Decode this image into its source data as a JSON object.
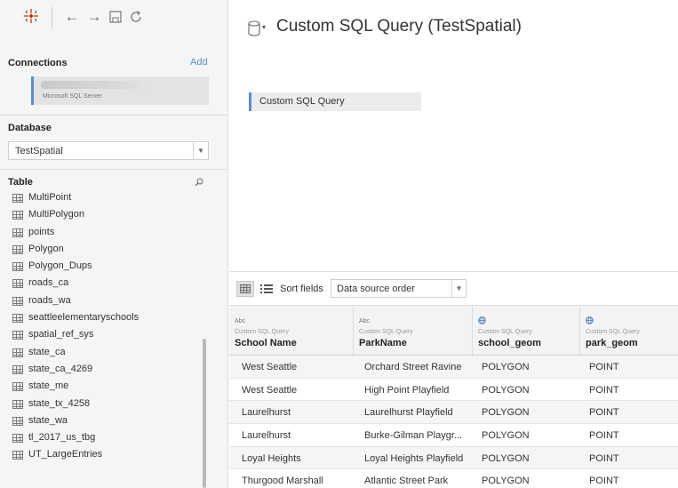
{
  "toolbar": {
    "icons": [
      "tableau-logo-icon",
      "back-arrow-icon",
      "forward-arrow-icon",
      "save-icon",
      "refresh-icon"
    ]
  },
  "connections": {
    "title": "Connections",
    "add_label": "Add",
    "items": [
      {
        "type": "Microsoft SQL Server"
      }
    ]
  },
  "database": {
    "title": "Database",
    "selected": "TestSpatial"
  },
  "tables": {
    "title": "Table",
    "items": [
      "MultiPoint",
      "MultiPolygon",
      "points",
      "Polygon",
      "Polygon_Dups",
      "roads_ca",
      "roads_wa",
      "seattleelementaryschools",
      "spatial_ref_sys",
      "state_ca",
      "state_ca_4269",
      "state_me",
      "state_tx_4258",
      "state_wa",
      "tl_2017_us_tbg",
      "UT_LargeEntries"
    ]
  },
  "main": {
    "title": "Custom SQL Query (TestSpatial)",
    "canvas_item": "Custom SQL Query"
  },
  "grid_toolbar": {
    "sort_label": "Sort fields",
    "sort_value": "Data source order"
  },
  "grid": {
    "columns": [
      {
        "type": "Abc",
        "source": "Custom SQL Query",
        "name": "School Name"
      },
      {
        "type": "Abc",
        "source": "Custom SQL Query",
        "name": "ParkName"
      },
      {
        "type": "globe",
        "source": "Custom SQL Query",
        "name": "school_geom"
      },
      {
        "type": "globe",
        "source": "Custom SQL Query",
        "name": "park_geom"
      }
    ],
    "rows": [
      [
        "West Seattle",
        "Orchard Street Ravine",
        "POLYGON",
        "POINT"
      ],
      [
        "West Seattle",
        "High Point Playfield",
        "POLYGON",
        "POINT"
      ],
      [
        "Laurelhurst",
        "Laurelhurst Playfield",
        "POLYGON",
        "POINT"
      ],
      [
        "Laurelhurst",
        "Burke-Gilman Playgr...",
        "POLYGON",
        "POINT"
      ],
      [
        "Loyal Heights",
        "Loyal Heights Playfield",
        "POLYGON",
        "POINT"
      ],
      [
        "Thurgood Marshall",
        "Atlantic Street Park",
        "POLYGON",
        "POINT"
      ]
    ]
  },
  "colors": {
    "accent": "#5a8fc5",
    "sidebar_bg": "#f5f5f5"
  }
}
